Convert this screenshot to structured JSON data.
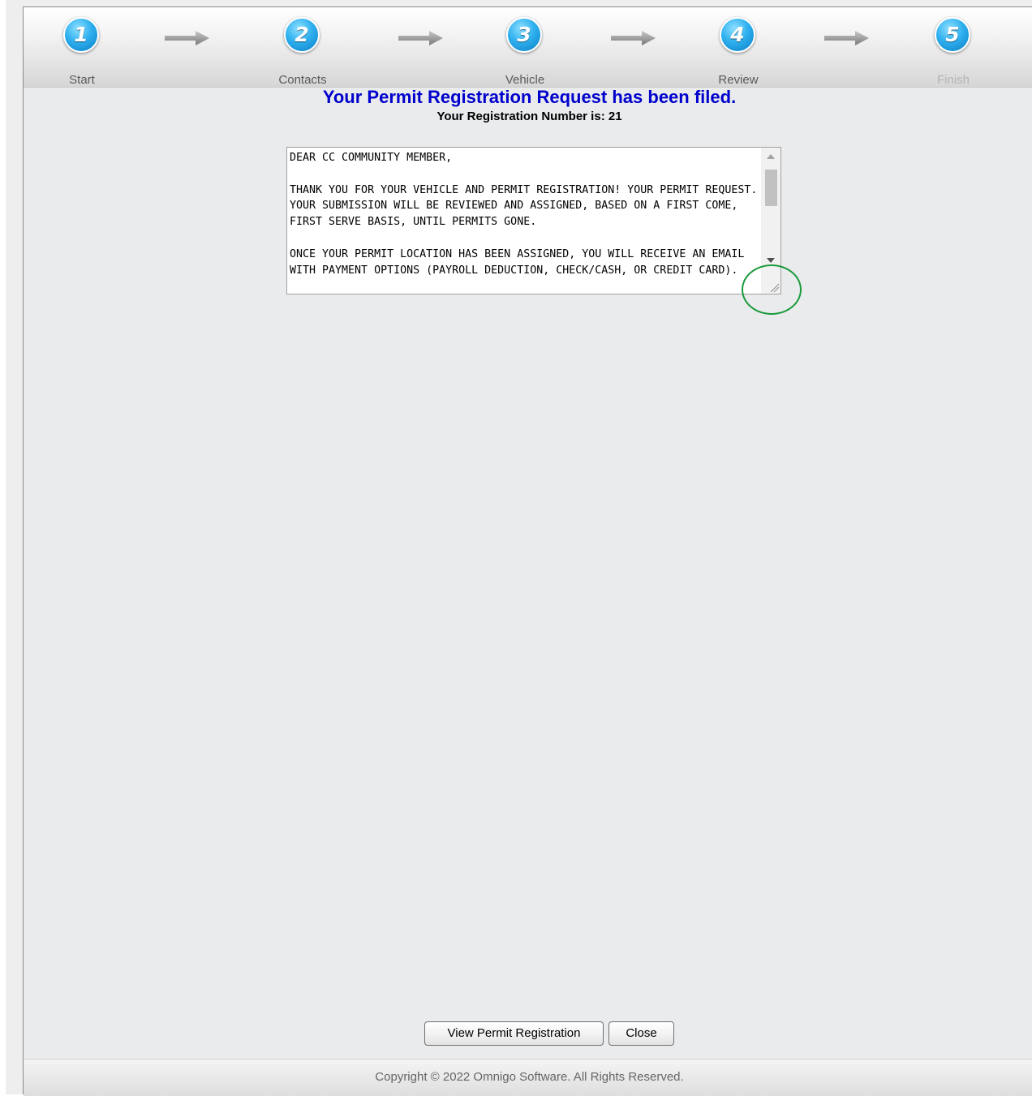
{
  "wizard": {
    "steps": [
      {
        "number": "1",
        "label": "Start"
      },
      {
        "number": "2",
        "label": "Contacts"
      },
      {
        "number": "3",
        "label": "Vehicle"
      },
      {
        "number": "4",
        "label": "Review"
      },
      {
        "number": "5",
        "label": "Finish"
      }
    ],
    "current_step": 5
  },
  "confirmation": {
    "heading": "Your Permit Registration Request has been filed.",
    "registration_line": "Your Registration Number is: 21"
  },
  "letter": {
    "text": "DEAR CC COMMUNITY MEMBER,\n\nTHANK YOU FOR YOUR VEHICLE AND PERMIT REGISTRATION! YOUR PERMIT REQUEST.  YOUR SUBMISSION WILL BE REVIEWED AND ASSIGNED, BASED ON A FIRST COME, FIRST SERVE BASIS, UNTIL PERMITS GONE.\n\nONCE YOUR PERMIT LOCATION HAS BEEN ASSIGNED, YOU WILL RECEIVE AN EMAIL WITH PAYMENT OPTIONS (PAYROLL DEDUCTION, CHECK/CASH, OR CREDIT CARD)."
  },
  "buttons": {
    "view_label": "View Permit Registration",
    "close_label": "Close"
  },
  "footer": {
    "copyright": "Copyright © 2022 Omnigo Software. All Rights Reserved."
  },
  "colors": {
    "heading": "#0000cc",
    "step_circle": "#1e9fe0",
    "highlight_ring": "#1a9a3a"
  }
}
